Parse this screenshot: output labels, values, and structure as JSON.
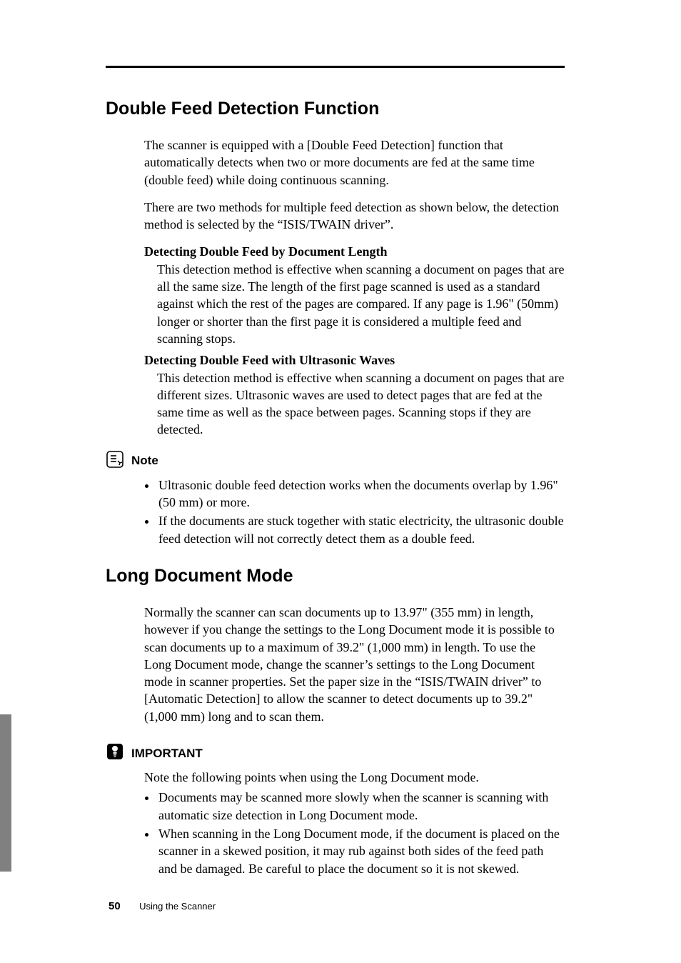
{
  "section1": {
    "heading": "Double Feed Detection Function",
    "p1": "The scanner is equipped with a [Double Feed Detection] function that automatically detects when two or more documents are fed at the same time (double feed) while doing continuous scanning.",
    "p2": "There are two methods for multiple feed detection as shown below, the detection method is selected by the “ISIS/TWAIN driver”.",
    "sub1": {
      "title": "Detecting Double Feed by Document Length",
      "body": "This detection method is effective when scanning a document on pages that are all the same size. The length of the first page scanned is used as a standard against which the rest of the pages are compared. If any page is 1.96\" (50mm) longer or shorter than the first page it is considered a multiple feed and scanning stops."
    },
    "sub2": {
      "title": "Detecting Double Feed with Ultrasonic Waves",
      "body": "This detection method is effective when scanning a document on pages that are different sizes. Ultrasonic waves are used to detect pages that are fed at the same time as well as the space between pages. Scanning stops if they are detected."
    },
    "note": {
      "label": "Note",
      "items": [
        "Ultrasonic double feed detection works when the documents overlap by 1.96\" (50 mm) or more.",
        "If the documents are stuck together with static electricity, the ultrasonic double feed detection will not correctly detect them as a double feed."
      ]
    }
  },
  "section2": {
    "heading": "Long Document Mode",
    "p1": "Normally the scanner can scan documents up to 13.97\" (355 mm) in length, however if you change the settings to the Long Document mode it is possible to scan documents up to a maximum of 39.2\" (1,000 mm) in length. To use the Long Document mode, change the scanner’s settings to the Long Document mode in scanner properties. Set the paper size in the “ISIS/TWAIN driver” to [Automatic Detection] to allow the scanner to detect documents up to 39.2\" (1,000 mm) long and to scan them.",
    "important": {
      "label": "IMPORTANT",
      "intro": "Note the following points when using the Long Document mode.",
      "items": [
        "Documents may be scanned more slowly when the scanner is scanning with automatic size detection in Long Document mode.",
        "When scanning in the Long Document mode, if the document is placed on the scanner in a skewed position, it may rub against both sides of the feed path and be damaged. Be careful to place the document so it is not skewed."
      ]
    }
  },
  "footer": {
    "page": "50",
    "title": "Using the Scanner"
  }
}
